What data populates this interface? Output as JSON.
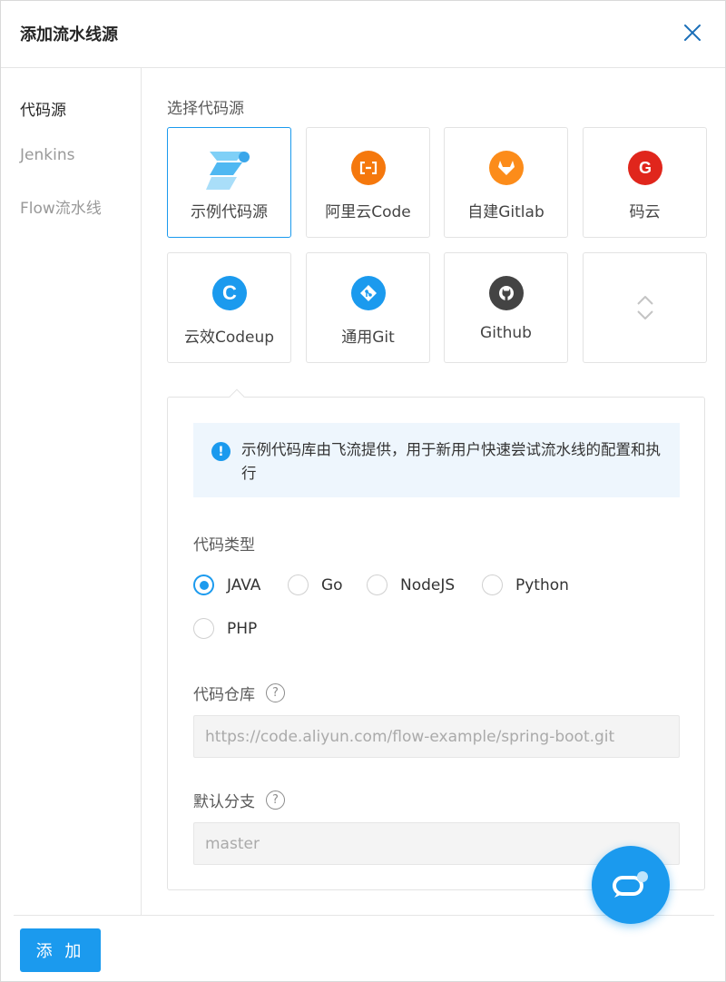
{
  "dialog": {
    "title": "添加流水线源"
  },
  "sidebar": {
    "items": [
      {
        "label": "代码源",
        "active": true
      },
      {
        "label": "Jenkins",
        "active": false
      },
      {
        "label": "Flow流水线",
        "active": false
      }
    ]
  },
  "main": {
    "section_label": "选择代码源",
    "sources": [
      {
        "label": "示例代码源",
        "icon": "flow-logo-icon",
        "selected": true
      },
      {
        "label": "阿里云Code",
        "icon": "aliyun-icon",
        "color": "#f5780d"
      },
      {
        "label": "自建Gitlab",
        "icon": "gitlab-icon",
        "color": "#fc8c1a"
      },
      {
        "label": "码云",
        "icon": "gitee-icon",
        "color": "#e0261c",
        "glyph": "G"
      },
      {
        "label": "云效Codeup",
        "icon": "codeup-icon",
        "color": "#1b9aee",
        "glyph": "C"
      },
      {
        "label": "通用Git",
        "icon": "git-icon",
        "color": "#1b9aee"
      },
      {
        "label": "Github",
        "icon": "github-icon",
        "color": "#444444"
      },
      {
        "label": "",
        "icon": "expand-icon"
      }
    ],
    "info_text": "示例代码库由飞流提供，用于新用户快速尝试流水线的配置和执行",
    "code_type": {
      "label": "代码类型",
      "options": [
        "JAVA",
        "Go",
        "NodeJS",
        "Python",
        "PHP"
      ],
      "selected": "JAVA"
    },
    "repo": {
      "label": "代码仓库",
      "value": "https://code.aliyun.com/flow-example/spring-boot.git"
    },
    "branch": {
      "label": "默认分支",
      "value": "master"
    }
  },
  "footer": {
    "add_label": "添 加"
  },
  "colors": {
    "accent": "#1b9aee"
  }
}
